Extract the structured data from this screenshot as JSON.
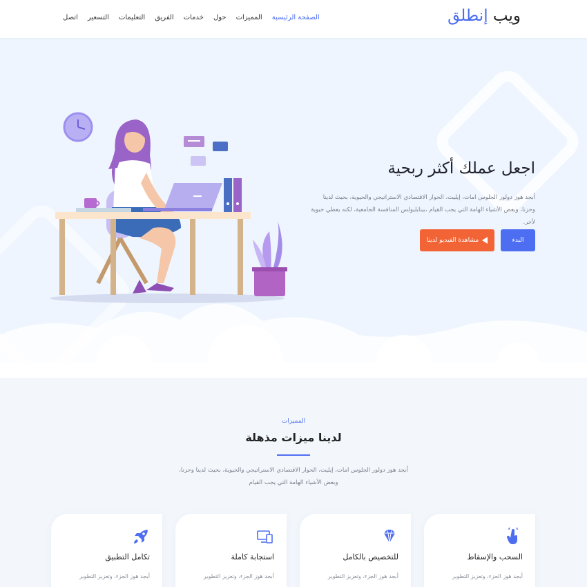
{
  "header": {
    "logo_main": "ويب ",
    "logo_accent": "إنطلق",
    "nav": [
      {
        "label": "الصفحة الرئيسية",
        "active": true
      },
      {
        "label": "المميزات",
        "active": false
      },
      {
        "label": "حول",
        "active": false
      },
      {
        "label": "خدمات",
        "active": false
      },
      {
        "label": "الفريق",
        "active": false
      },
      {
        "label": "التعليمات",
        "active": false
      },
      {
        "label": "التسعير",
        "active": false
      },
      {
        "label": "اتصل",
        "active": false
      }
    ]
  },
  "hero": {
    "title": "اجعل عملك أكثر ربحية",
    "text": "أبجد هوز دولور الجلوس امات، إيليت، الحوار الاقتصادي الاستراتيجي والحيوية، بحيث لدينا وحزنا، وبعض الأشياء الهامة التي يجب القيام ،بينايليولس المنافسة الجامعية، لكنه يعطي حيوية لأخر.",
    "btn_start": "البدء",
    "btn_video": "مشاهدة الفيديو لدينا"
  },
  "features": {
    "kicker": "المميزات",
    "title": "لدينا ميزات مذهلة",
    "desc": "أبجد هوز دولور الجلوس امات، إيليت، الحوار الاقتصادي الاستراتيجي والحيوية، بحيث لدينا وحزنا، وبعض الأشياء الهامة التي يجب القيام",
    "cards": [
      {
        "title": "السحب والإسقاط",
        "text": "أبجد هوز الجزء، وتعزيز التطوير",
        "icon": "hand-pointer-icon"
      },
      {
        "title": "للتخصيص بالكامل",
        "text": "أبجد هوز الجزء، وتعزيز التطوير",
        "icon": "diamond-icon"
      },
      {
        "title": "استجابة كاملة",
        "text": "أبجد هوز الجزء، وتعزيز التطوير",
        "icon": "devices-icon"
      },
      {
        "title": "تكامل التطبيق",
        "text": "أبجد هوز الجزء، وتعزيز التطوير",
        "icon": "rocket-icon"
      }
    ]
  },
  "colors": {
    "accent": "#4e6ef2",
    "orange": "#f26436",
    "hero_bg": "#eef5fe"
  }
}
